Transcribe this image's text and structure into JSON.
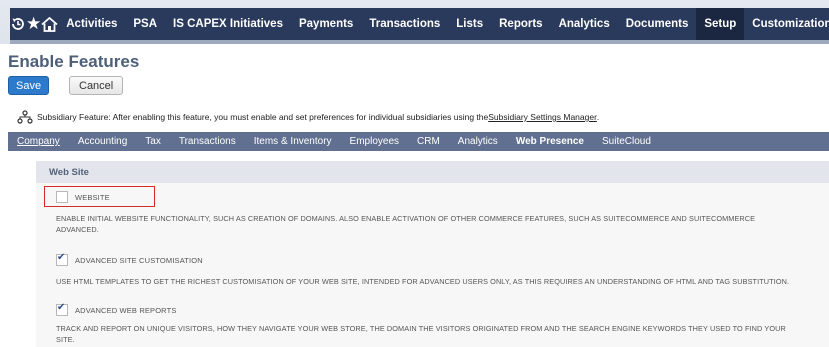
{
  "nav": {
    "icons": [
      "recent-records-icon",
      "favorites-star-icon",
      "home-icon"
    ],
    "items": [
      "Activities",
      "PSA",
      "IS CAPEX Initiatives",
      "Payments",
      "Transactions",
      "Lists",
      "Reports",
      "Analytics",
      "Documents",
      "Setup",
      "Customization"
    ],
    "active": "Setup"
  },
  "page": {
    "title": "Enable Features",
    "save_label": "Save",
    "cancel_label": "Cancel"
  },
  "subsidiary": {
    "text": "Subsidiary Feature: After enabling this feature, you must enable and set preferences for individual subsidiaries using the ",
    "link": "Subsidiary Settings Manager",
    "suffix": "."
  },
  "subtabs": {
    "items": [
      "Company",
      "Accounting",
      "Tax",
      "Transactions",
      "Items & Inventory",
      "Employees",
      "CRM",
      "Analytics",
      "Web Presence",
      "SuiteCloud"
    ],
    "active": "Web Presence"
  },
  "section": {
    "title": "Web Site",
    "features": [
      {
        "label": "WEBSITE",
        "checked": false,
        "desc_line1": "ENABLE INITIAL WEBSITE FUNCTIONALITY, SUCH AS CREATION OF DOMAINS. ALSO ENABLE ACTIVATION OF OTHER COMMERCE FEATURES, SUCH AS SUITECOMMERCE AND SUITECOMMERCE",
        "desc_line2": "ADVANCED."
      },
      {
        "label": "ADVANCED SITE CUSTOMISATION",
        "checked": true,
        "desc_line1": "USE HTML TEMPLATES TO GET THE RICHEST CUSTOMISATION OF YOUR WEB SITE, INTENDED FOR ADVANCED USERS ONLY, AS THIS REQUIRES AN UNDERSTANDING OF HTML AND TAG SUBSTITUTION."
      },
      {
        "label": "ADVANCED WEB REPORTS",
        "checked": true,
        "desc_line1": "TRACK AND REPORT ON UNIQUE VISITORS, HOW THEY NAVIGATE YOUR WEB STORE, THE DOMAIN THE VISITORS ORIGINATED FROM AND THE SEARCH ENGINE KEYWORDS THEY USED TO FIND YOUR",
        "desc_line2": "SITE."
      }
    ]
  },
  "colors": {
    "navbar": "#2a3a5c",
    "subtabs": "#617090",
    "save_button": "#2d79cc",
    "highlight": "#d42a2a"
  }
}
